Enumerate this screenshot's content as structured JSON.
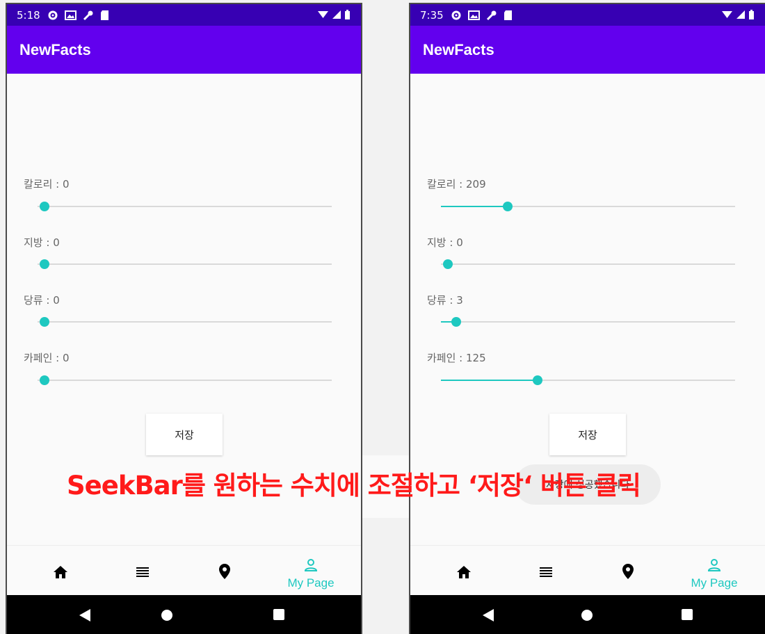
{
  "left_screen": {
    "status_time": "5:18",
    "app_title": "NewFacts",
    "seekbars": [
      {
        "label": "칼로리 : 0",
        "value": 0,
        "max": 1000
      },
      {
        "label": "지방 :   0",
        "value": 0,
        "max": 100
      },
      {
        "label": "당류 :   0",
        "value": 0,
        "max": 100
      },
      {
        "label": "카페인 : 0",
        "value": 0,
        "max": 400
      }
    ],
    "save_label": "저장",
    "nav": {
      "home_icon": "home-icon",
      "list_icon": "list-icon",
      "location_icon": "location-pin-icon",
      "mypage_icon": "person-icon",
      "mypage_label": "My Page"
    }
  },
  "right_screen": {
    "status_time": "7:35",
    "app_title": "NewFacts",
    "seekbars": [
      {
        "label": "칼로리 : 209",
        "value": 209,
        "max": 1000
      },
      {
        "label": "지방 :   0",
        "value": 0,
        "max": 100
      },
      {
        "label": "당류 :   3",
        "value": 3,
        "max": 100
      },
      {
        "label": "카페인 : 125",
        "value": 125,
        "max": 400
      }
    ],
    "save_label": "저장",
    "toast": "저장에 성공했습니다",
    "nav": {
      "mypage_label": "My Page"
    }
  },
  "caption": "SeekBar를 원하는 수치에 조절하고  ‘저장‘ 버튼 클릭",
  "colors": {
    "primary": "#6200ee",
    "status": "#3700b3",
    "accent": "#1ec8c0",
    "caption": "#ff1a1a"
  }
}
